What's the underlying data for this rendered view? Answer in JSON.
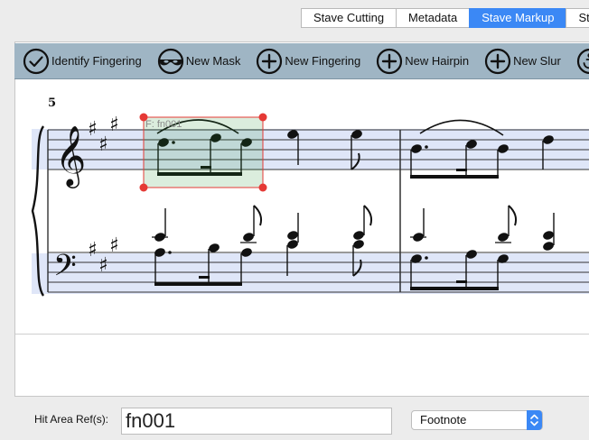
{
  "tabs": [
    {
      "label": "Stave Cutting",
      "active": false
    },
    {
      "label": "Metadata",
      "active": false
    },
    {
      "label": "Stave Markup",
      "active": true
    },
    {
      "label": "Sta",
      "active": false
    }
  ],
  "toolbar": {
    "identify_fingering": "Identify Fingering",
    "new_mask": "New Mask",
    "new_fingering": "New Fingering",
    "new_hairpin": "New Hairpin",
    "new_slur": "New Slur"
  },
  "score": {
    "measure_number": "5",
    "selection_label": "F: fn001",
    "selection_color": "#e53935",
    "stave_highlight": "#dfe6f8"
  },
  "form": {
    "hit_area_label": "Hit Area Ref(s):",
    "hit_area_value": "fn001",
    "type_value": "Footnote"
  }
}
